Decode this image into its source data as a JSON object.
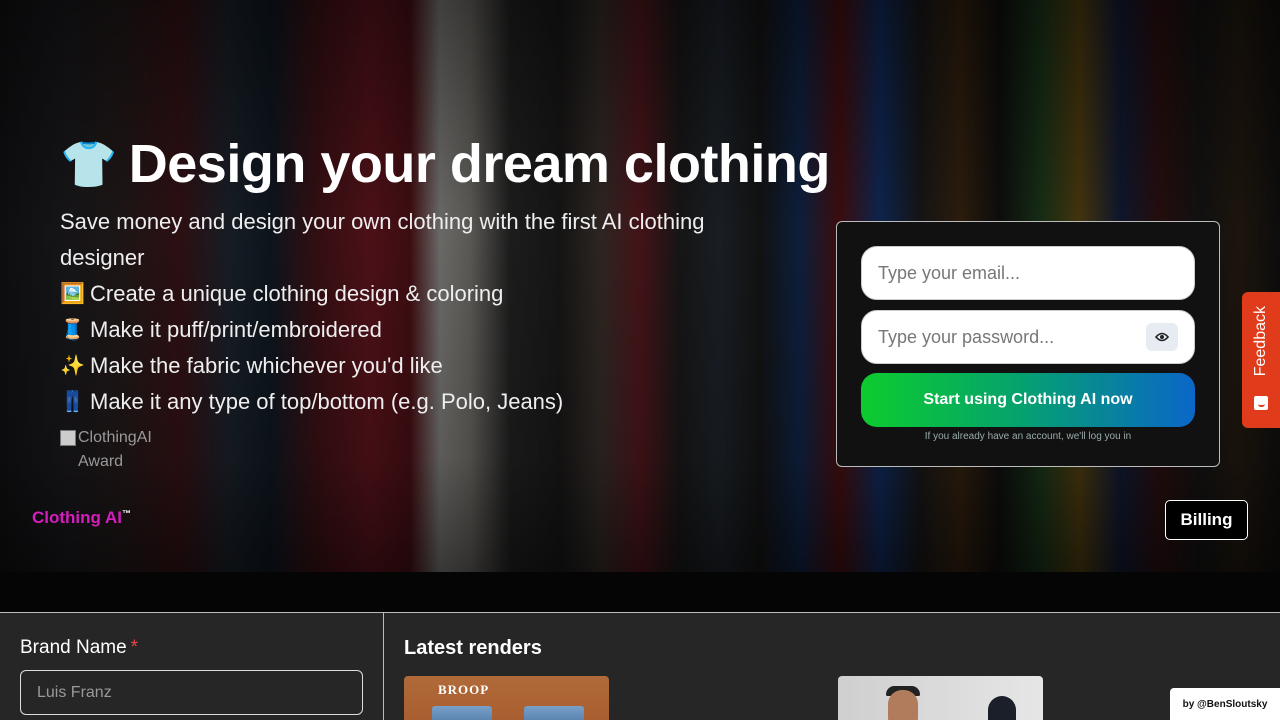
{
  "hero": {
    "title_icon": "shirt-emoji",
    "title_glyph": "👕",
    "title": "Design your dream clothing",
    "subtitle": "Save money and design your own clothing with the first AI clothing designer",
    "features": [
      {
        "icon": "picture-emoji",
        "glyph": "🖼️",
        "text": "Create a unique clothing design & coloring"
      },
      {
        "icon": "thread-emoji",
        "glyph": "🧵",
        "text": "Make it puff/print/embroidered"
      },
      {
        "icon": "sparkles-emoji",
        "glyph": "✨",
        "text": "Make the fabric whichever you'd like"
      },
      {
        "icon": "jeans-emoji",
        "glyph": "👖",
        "text": "Make it any type of top/bottom (e.g. Polo, Jeans)"
      }
    ],
    "award_alt": "ClothingAI Award"
  },
  "signup": {
    "email_placeholder": "Type your email...",
    "password_placeholder": "Type your password...",
    "cta_label": "Start using Clothing AI now",
    "note": "If you already have an account, we'll log you in"
  },
  "footer_bar": {
    "brand": "Clothing AI",
    "brand_mark": "™",
    "billing_label": "Billing"
  },
  "feedback": {
    "label": "Feedback"
  },
  "form": {
    "brand_name_label": "Brand Name",
    "required_mark": "*",
    "brand_name_placeholder": "Luis Franz"
  },
  "renders": {
    "title": "Latest renders",
    "items": [
      {
        "label": "BROOP"
      }
    ]
  },
  "credit": "by @BenSloutsky",
  "colors": {
    "brand": "#d41dbd",
    "cta_start": "#0dcc2e",
    "cta_end": "#0a67c8",
    "feedback": "#e03b1a",
    "required": "#e84545"
  }
}
